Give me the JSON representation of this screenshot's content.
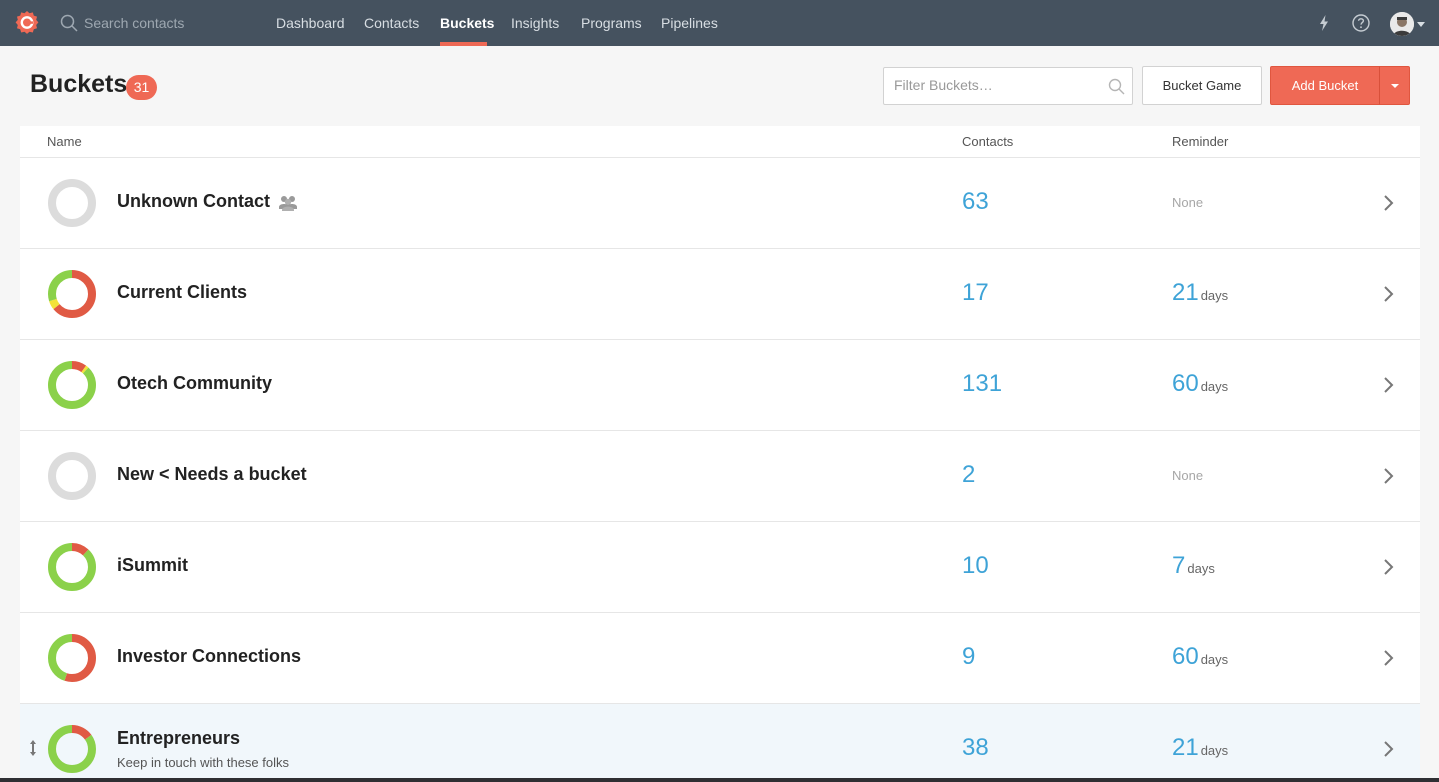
{
  "nav": {
    "search_placeholder": "Search contacts",
    "items": [
      {
        "label": "Dashboard",
        "active": false
      },
      {
        "label": "Contacts",
        "active": false
      },
      {
        "label": "Buckets",
        "active": true
      },
      {
        "label": "Insights",
        "active": false
      },
      {
        "label": "Programs",
        "active": false
      },
      {
        "label": "Pipelines",
        "active": false
      }
    ],
    "icons": [
      "logo-icon",
      "search-icon",
      "lightning-icon",
      "help-icon",
      "avatar",
      "chevron-down-icon"
    ]
  },
  "header": {
    "title": "Buckets",
    "count": "31",
    "filter_placeholder": "Filter Buckets…",
    "bucket_game_label": "Bucket Game",
    "add_bucket_label": "Add Bucket"
  },
  "table": {
    "columns": {
      "name": "Name",
      "contacts": "Contacts",
      "reminder": "Reminder"
    },
    "rows": [
      {
        "name": "Unknown Contact",
        "description": "",
        "contacts": "63",
        "reminder_value": "",
        "reminder_unit": "",
        "reminder_none": "None",
        "health": {
          "red": 0,
          "yellow": 0,
          "green": 0
        },
        "group_icon": true
      },
      {
        "name": "Current Clients",
        "description": "",
        "contacts": "17",
        "reminder_value": "21",
        "reminder_unit": "days",
        "reminder_none": "",
        "health": {
          "red": 0.64,
          "yellow": 0.06,
          "green": 0.3
        },
        "group_icon": false
      },
      {
        "name": "Otech Community",
        "description": "",
        "contacts": "131",
        "reminder_value": "60",
        "reminder_unit": "days",
        "reminder_none": "",
        "health": {
          "red": 0.1,
          "yellow": 0.02,
          "green": 0.88
        },
        "group_icon": false
      },
      {
        "name": "New < Needs a bucket",
        "description": "",
        "contacts": "2",
        "reminder_value": "",
        "reminder_unit": "",
        "reminder_none": "None",
        "health": {
          "red": 0,
          "yellow": 0,
          "green": 0
        },
        "group_icon": false
      },
      {
        "name": "iSummit",
        "description": "",
        "contacts": "10",
        "reminder_value": "7",
        "reminder_unit": "days",
        "reminder_none": "",
        "health": {
          "red": 0.12,
          "yellow": 0,
          "green": 0.88
        },
        "group_icon": false
      },
      {
        "name": "Investor Connections",
        "description": "",
        "contacts": "9",
        "reminder_value": "60",
        "reminder_unit": "days",
        "reminder_none": "",
        "health": {
          "red": 0.55,
          "yellow": 0,
          "green": 0.45
        },
        "group_icon": false
      },
      {
        "name": "Entrepreneurs",
        "description": "Keep in touch with these folks",
        "contacts": "38",
        "reminder_value": "21",
        "reminder_unit": "days",
        "reminder_none": "",
        "health": {
          "red": 0.15,
          "yellow": 0,
          "green": 0.85
        },
        "group_icon": false
      }
    ]
  },
  "colors": {
    "accent": "#ef6955",
    "nav_bg": "#45525f",
    "link_blue": "#3ea3d7",
    "health_red": "#e05a44",
    "health_yellow": "#f3e33a",
    "health_green": "#8bd14a",
    "health_empty": "#dcdcdc"
  }
}
